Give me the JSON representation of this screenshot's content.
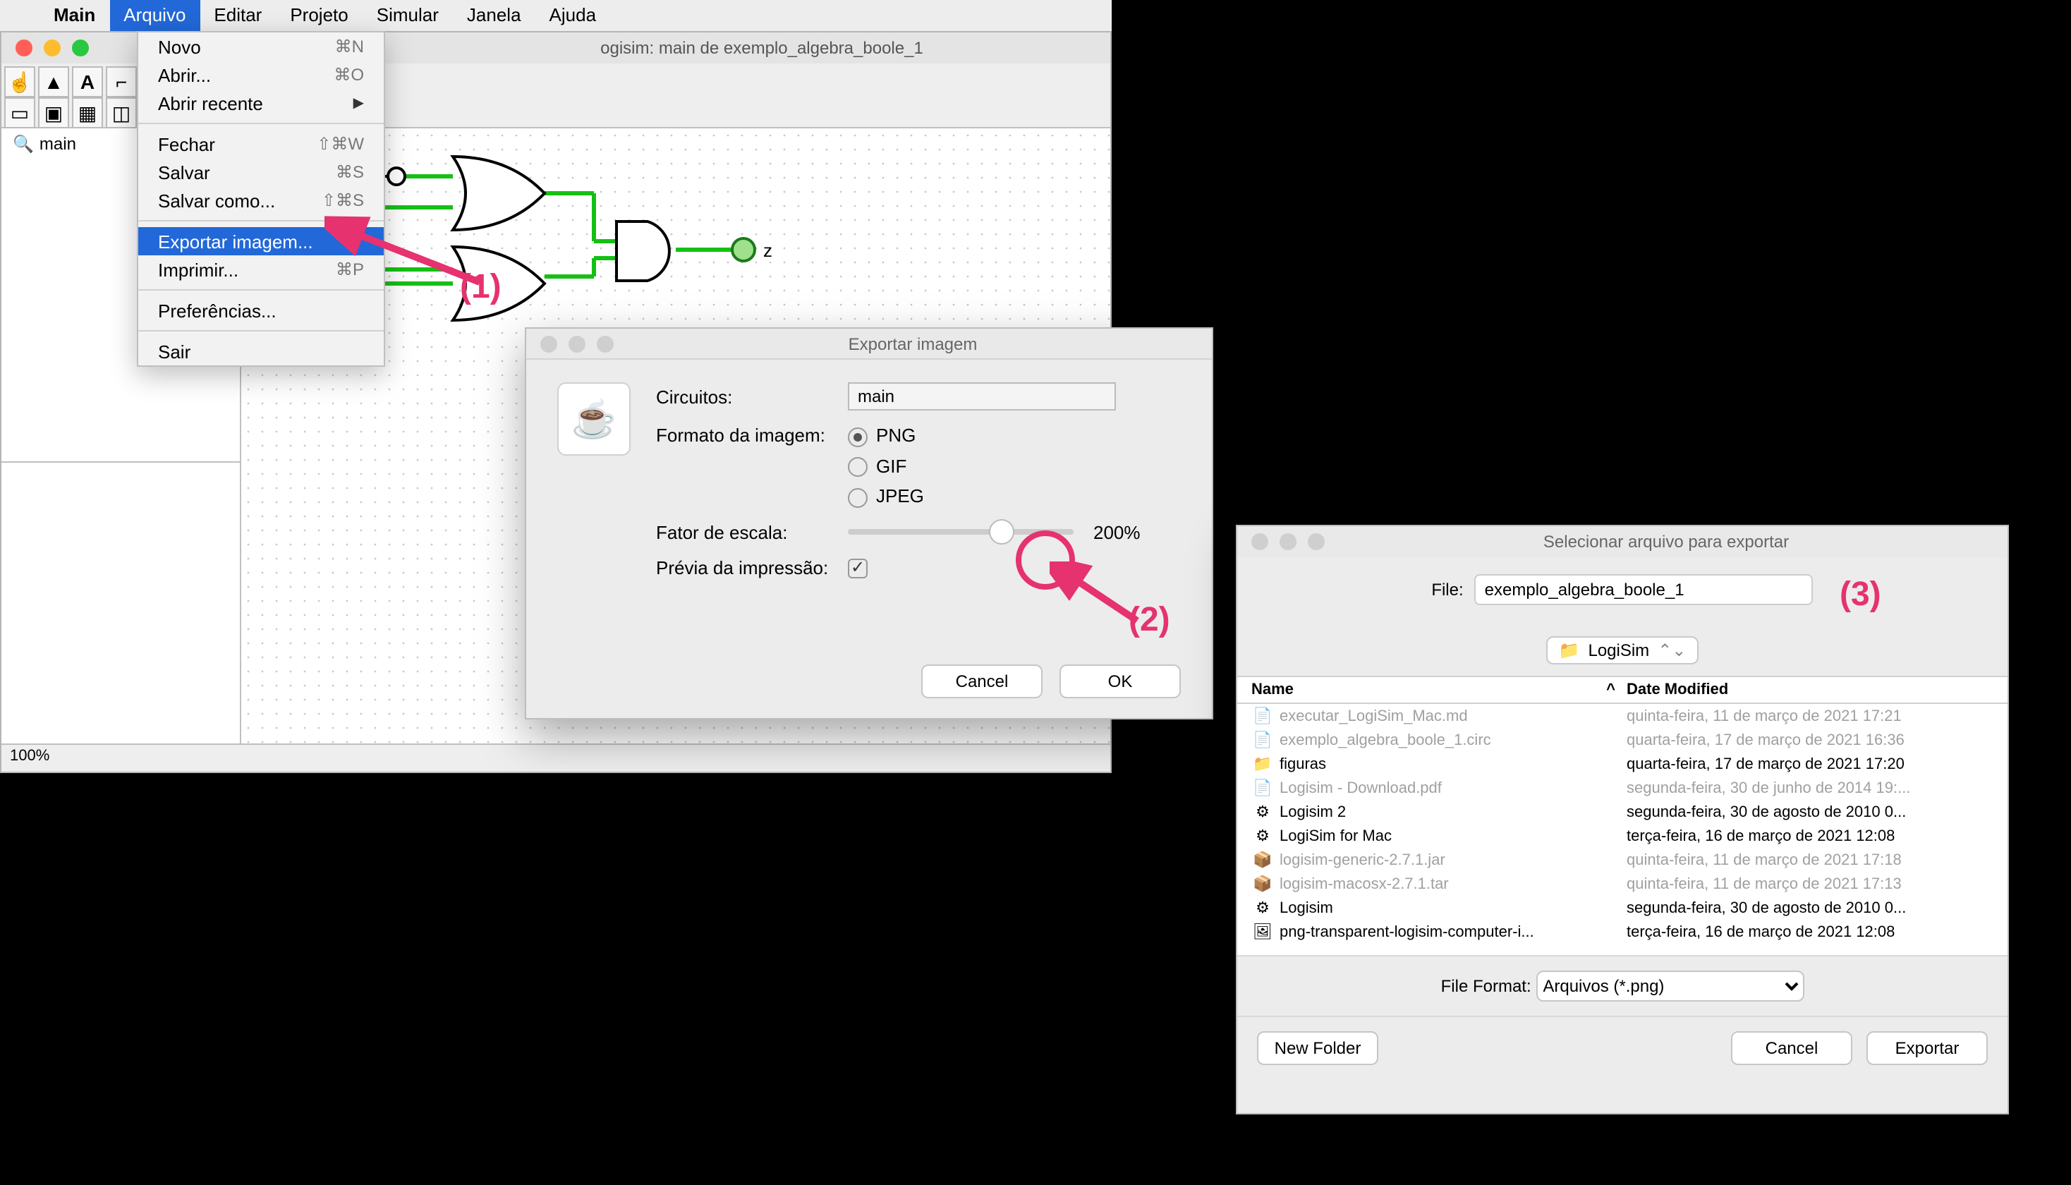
{
  "menubar": {
    "items": [
      "Main",
      "Arquivo",
      "Editar",
      "Projeto",
      "Simular",
      "Janela",
      "Ajuda"
    ]
  },
  "dropdown": {
    "items": [
      {
        "label": "Novo",
        "sc": "⌘N"
      },
      {
        "label": "Abrir...",
        "sc": "⌘O"
      },
      {
        "label": "Abrir recente",
        "arrow": true
      },
      {
        "sep": true
      },
      {
        "label": "Fechar",
        "sc": "⇧⌘W"
      },
      {
        "label": "Salvar",
        "sc": "⌘S"
      },
      {
        "label": "Salvar como...",
        "sc": "⇧⌘S"
      },
      {
        "sep": true
      },
      {
        "label": "Exportar imagem...",
        "selected": true
      },
      {
        "label": "Imprimir...",
        "sc": "⌘P"
      },
      {
        "sep": true
      },
      {
        "label": "Preferências..."
      },
      {
        "sep": true
      },
      {
        "label": "Sair"
      }
    ]
  },
  "window": {
    "title": "ogisim: main de exemplo_algebra_boole_1",
    "tree_item": "main",
    "zoom": "100%",
    "output_label": "z"
  },
  "annotations": {
    "a1": "(1)",
    "a2": "(2)",
    "a3": "(3)"
  },
  "export_dlg": {
    "title": "Exportar imagem",
    "circuits_label": "Circuitos:",
    "circuits_value": "main",
    "format_label": "Formato da imagem:",
    "formats": [
      "PNG",
      "GIF",
      "JPEG"
    ],
    "scale_label": "Fator de escala:",
    "scale_value": "200%",
    "preview_label": "Prévia da impressão:",
    "cancel": "Cancel",
    "ok": "OK"
  },
  "save_dlg": {
    "title": "Selecionar arquivo para exportar",
    "file_label": "File:",
    "file_value": "exemplo_algebra_boole_1",
    "folder": "LogiSim",
    "hdr_name": "Name",
    "hdr_date": "Date Modified",
    "files": [
      {
        "name": "executar_LogiSim_Mac.md",
        "date": "quinta-feira, 11 de março de 2021 17:21",
        "dim": true,
        "icon": "📄"
      },
      {
        "name": "exemplo_algebra_boole_1.circ",
        "date": "quarta-feira, 17 de março de 2021 16:36",
        "dim": true,
        "icon": "📄"
      },
      {
        "name": "figuras",
        "date": "quarta-feira, 17 de março de 2021 17:20",
        "dim": false,
        "icon": "📁"
      },
      {
        "name": "Logisim - Download.pdf",
        "date": "segunda-feira, 30 de junho de 2014 19:...",
        "dim": true,
        "icon": "📄"
      },
      {
        "name": "Logisim 2",
        "date": "segunda-feira, 30 de agosto de 2010 0...",
        "dim": false,
        "icon": "⚙"
      },
      {
        "name": "LogiSim for Mac",
        "date": "terça-feira, 16 de março de 2021 12:08",
        "dim": false,
        "icon": "⚙"
      },
      {
        "name": "logisim-generic-2.7.1.jar",
        "date": "quinta-feira, 11 de março de 2021 17:18",
        "dim": true,
        "icon": "📦"
      },
      {
        "name": "logisim-macosx-2.7.1.tar",
        "date": "quinta-feira, 11 de março de 2021 17:13",
        "dim": true,
        "icon": "📦"
      },
      {
        "name": "Logisim",
        "date": "segunda-feira, 30 de agosto de 2010 0...",
        "dim": false,
        "icon": "⚙"
      },
      {
        "name": "png-transparent-logisim-computer-i...",
        "date": "terça-feira, 16 de março de 2021 12:08",
        "dim": false,
        "icon": "🖼"
      }
    ],
    "format_label": "File Format:",
    "format_value": "Arquivos (*.png)",
    "new_folder": "New Folder",
    "cancel": "Cancel",
    "export": "Exportar"
  }
}
